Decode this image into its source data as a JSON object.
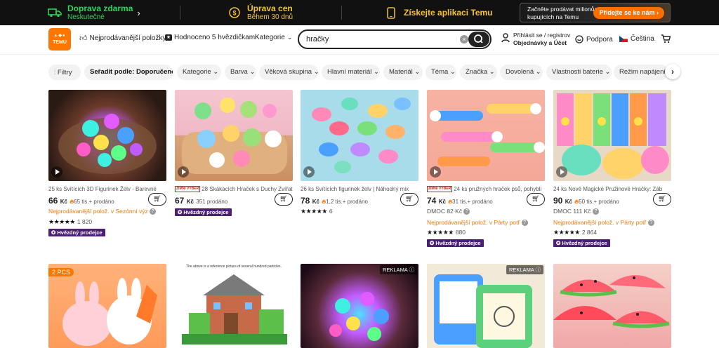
{
  "promo": {
    "shipping_title": "Doprava zdarma",
    "shipping_sub": "Neskutečné",
    "price_title": "Úprava cen",
    "price_sub": "Během 30 dnů",
    "app_text": "Získejte aplikaci Temu",
    "sell_text": "Začněte prodávat milionům kupujících na Temu",
    "sell_button": "Přidejte se ke nám"
  },
  "header": {
    "logo": "TEMU",
    "nav_bestsellers": "Nejprodávanější položky",
    "nav_rated": "Hodnoceno 5 hvězdičkami",
    "nav_categories": "Kategorie",
    "search_value": "hračky",
    "account_line1": "Přihlásit se / registrov",
    "account_line2": "Objednávky a Účet",
    "support": "Podpora",
    "language": "Čeština"
  },
  "filters": [
    "Filtry",
    "Seřadit podle: Doporučené",
    "Kategorie",
    "Barva",
    "Věková skupina",
    "Hlavní materiál",
    "Materiál",
    "Téma",
    "Značka",
    "Dovolená",
    "Vlastnosti baterie",
    "Režim napájení"
  ],
  "products": [
    {
      "title": "25 ks Svítících 3D Figurinek Želv - Barevné",
      "price": "66",
      "currency": "Kč",
      "sold": "65 tis.+ prodáno",
      "line3": "Nejprodávanější polož. v Sezónní výz",
      "rating_count": "1 820",
      "star_seller": "Hvězdný prodejce"
    },
    {
      "badge": "ZIMNÍ VÝBĚR",
      "title": "28 Skákacích Hraček s Duchy Zvířat",
      "price": "67",
      "currency": "Kč",
      "sold": "351 prodáno",
      "star_seller": "Hvězdný prodejce"
    },
    {
      "title": "26 ks Svítících figurinek želv | Náhodný mix",
      "price": "78",
      "currency": "Kč",
      "sold": "1,2 tis.+ prodáno",
      "rating_count": "6"
    },
    {
      "badge": "ZIMNÍ VÝBĚR",
      "title": "24 ks pružných hraček psů, pohybli",
      "price": "74",
      "currency": "Kč",
      "sold": "31 tis.+ prodáno",
      "dmoc": "DMOC 82 Kč",
      "line3": "Nejprodávanější polož. v Párty potř",
      "rating_count": "880",
      "star_seller": "Hvězdný prodejce"
    },
    {
      "title": "24 ks Nové Magické Pružinové Hračky: Záb",
      "price": "90",
      "currency": "Kč",
      "sold": "50 tis.+ prodáno",
      "dmoc": "DMOC 111 Kč",
      "line3": "Nejprodávanější polož. v Párty potř",
      "rating_count": "2 864",
      "star_seller": "Hvězdný prodejce"
    }
  ],
  "row2": {
    "pcs": "2 PCS",
    "caption": "The above is a reference picture of several hundred particles.",
    "ad_label": "REKLAMA",
    "ad_label_2": "REKLAMA"
  },
  "colors": {
    "accent": "#fb7701",
    "promo_bg": "#111111",
    "star_seller_bg": "#4b1f75"
  }
}
